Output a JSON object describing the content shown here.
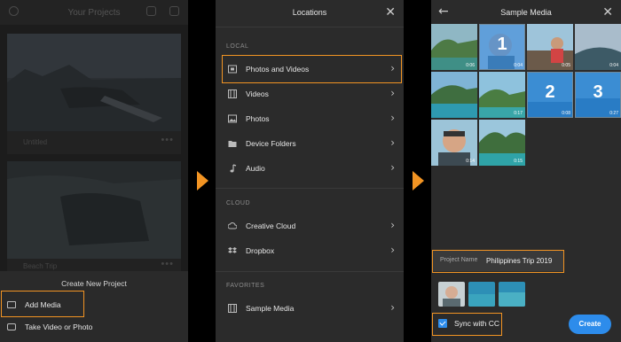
{
  "panel1": {
    "title": "Your Projects",
    "cards": [
      {
        "label": "Untitled"
      },
      {
        "label": "Beach Trip"
      }
    ],
    "sheet": {
      "title": "Create New Project",
      "add_media": "Add Media",
      "take_video": "Take Video or Photo"
    }
  },
  "panel2": {
    "title": "Locations",
    "sections": {
      "local": "LOCAL",
      "cloud": "CLOUD",
      "favorites": "FAVORITES"
    },
    "local_items": [
      {
        "label": "Photos and Videos",
        "icon": "photo-video-icon"
      },
      {
        "label": "Videos",
        "icon": "film-icon"
      },
      {
        "label": "Photos",
        "icon": "image-icon"
      },
      {
        "label": "Device Folders",
        "icon": "folder-icon"
      },
      {
        "label": "Audio",
        "icon": "music-note-icon"
      }
    ],
    "cloud_items": [
      {
        "label": "Creative Cloud",
        "icon": "creative-cloud-icon"
      },
      {
        "label": "Dropbox",
        "icon": "dropbox-icon"
      }
    ],
    "favorite_items": [
      {
        "label": "Sample Media",
        "icon": "film-icon"
      }
    ]
  },
  "panel3": {
    "title": "Sample Media",
    "tiles": [
      {
        "duration": "0:06",
        "selected_number": ""
      },
      {
        "duration": "0:04",
        "selected_number": "1"
      },
      {
        "duration": "0:05",
        "selected_number": ""
      },
      {
        "duration": "0:04",
        "selected_number": ""
      },
      {
        "duration": "",
        "selected_number": ""
      },
      {
        "duration": "0:17",
        "selected_number": ""
      },
      {
        "duration": "0:08",
        "selected_number": "2"
      },
      {
        "duration": "0:27",
        "selected_number": "3"
      },
      {
        "duration": "0:14",
        "selected_number": ""
      },
      {
        "duration": "0:15",
        "selected_number": ""
      }
    ],
    "project_name_label": "Project Name",
    "project_name_value": "Philippines Trip 2019",
    "sync_label": "Sync with CC",
    "sync_checked": true,
    "create_label": "Create"
  },
  "colors": {
    "accent": "#f29423",
    "primary_blue": "#2d8ceb"
  }
}
